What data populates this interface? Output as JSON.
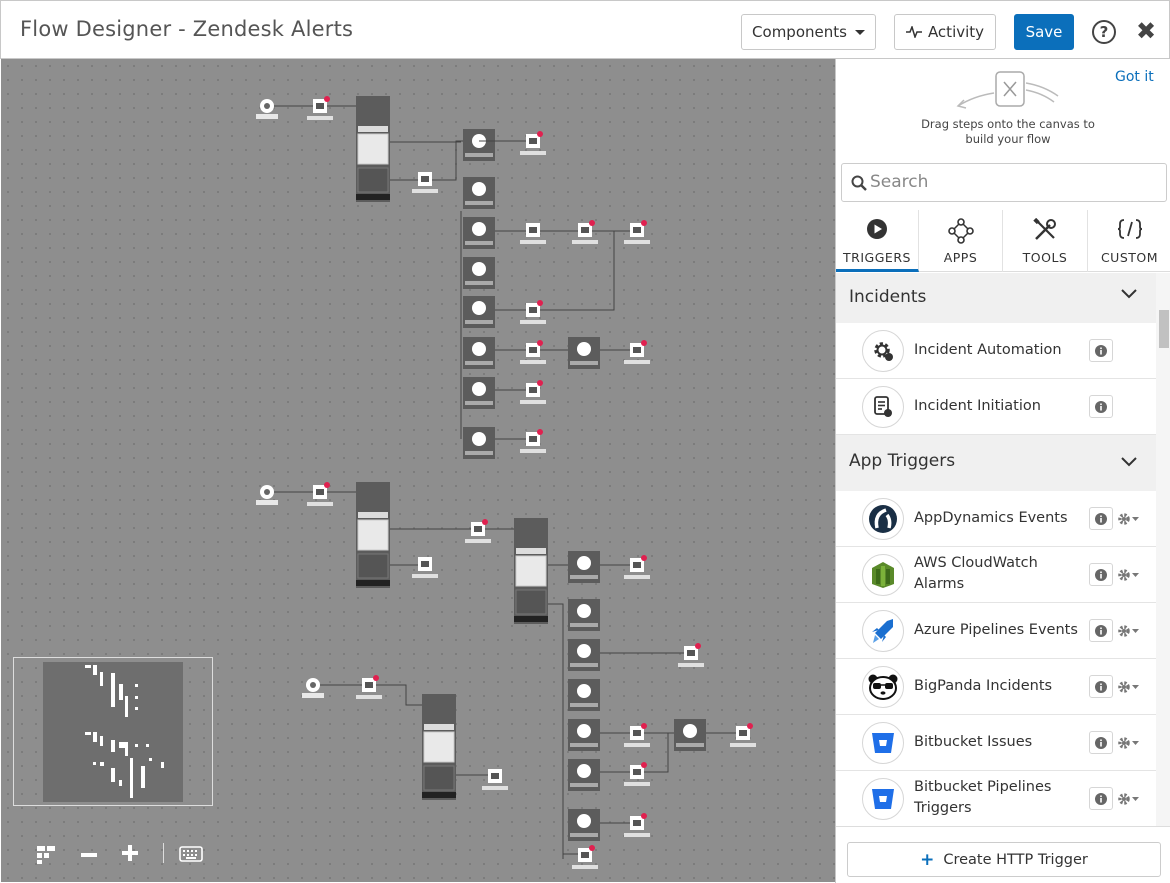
{
  "header": {
    "title": "Flow Designer - Zendesk Alerts",
    "components_label": "Components",
    "activity_label": "Activity",
    "save_label": "Save",
    "help_glyph": "?",
    "close_glyph": "✖"
  },
  "panel": {
    "got_it": "Got it",
    "hint_line1": "Drag steps onto the canvas to",
    "hint_line2": "build your flow",
    "search_placeholder": "Search",
    "tabs": [
      {
        "label": "TRIGGERS",
        "icon": "play-circle-icon",
        "active": true
      },
      {
        "label": "APPS",
        "icon": "apps-nodes-icon",
        "active": false
      },
      {
        "label": "TOOLS",
        "icon": "tools-icon",
        "active": false
      },
      {
        "label": "CUSTOM",
        "icon": "code-braces-icon",
        "active": false
      }
    ],
    "sections": [
      {
        "title": "Incidents",
        "items": [
          {
            "label": "Incident Automation",
            "icon": "gear-alert-icon"
          },
          {
            "label": "Incident Initiation",
            "icon": "document-alert-icon"
          }
        ]
      },
      {
        "title": "App Triggers",
        "items": [
          {
            "label": "AppDynamics Events",
            "icon": "appdynamics-icon"
          },
          {
            "label": "AWS CloudWatch",
            "label2": "Alarms",
            "icon": "aws-cloudwatch-icon"
          },
          {
            "label": "Azure Pipelines Events",
            "icon": "azure-pipelines-icon"
          },
          {
            "label": "BigPanda Incidents",
            "icon": "bigpanda-icon"
          },
          {
            "label": "Bitbucket Issues",
            "icon": "bitbucket-icon"
          },
          {
            "label": "Bitbucket Pipelines",
            "label2": "Triggers",
            "icon": "bitbucket-icon"
          }
        ]
      }
    ],
    "create_http_trigger": "Create HTTP Trigger"
  },
  "colors": {
    "accent": "#0b6fbb",
    "canvas": "#8e8e8e",
    "node": "#5f5f5f",
    "badge": "#e0204f"
  }
}
